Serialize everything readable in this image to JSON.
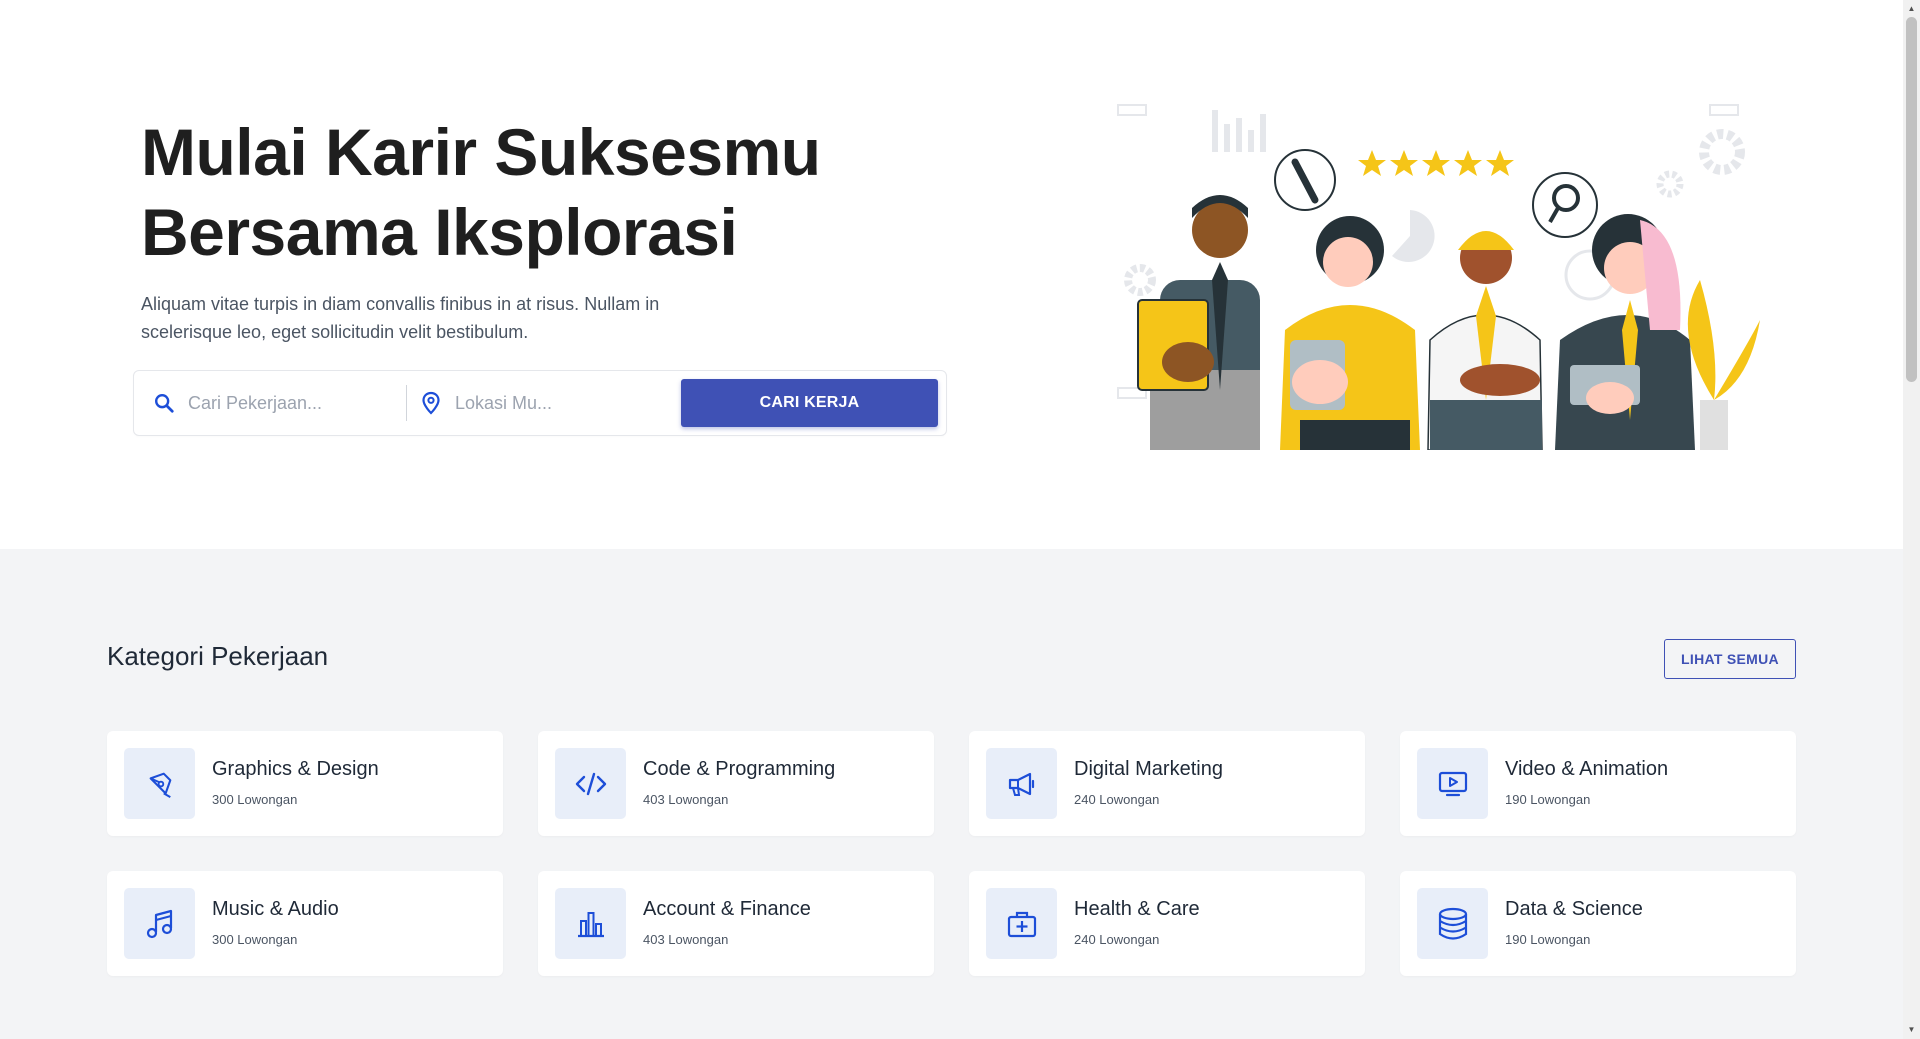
{
  "hero": {
    "title_line1": "Mulai Karir Suksesmu",
    "title_line2": "Bersama Iksplorasi",
    "subtitle": "Aliquam vitae turpis in diam convallis finibus in at risus. Nullam in scelerisque leo, eget sollicitudin velit bestibulum."
  },
  "search": {
    "job_placeholder": "Cari Pekerjaan...",
    "location_placeholder": "Lokasi Mu...",
    "button_label": "CARI KERJA"
  },
  "categories": {
    "title": "Kategori Pekerjaan",
    "see_all_label": "LIHAT SEMUA",
    "items": [
      {
        "name": "Graphics & Design",
        "count": "300 Lowongan",
        "icon": "pen-tool-icon"
      },
      {
        "name": "Code & Programming",
        "count": "403 Lowongan",
        "icon": "code-icon"
      },
      {
        "name": "Digital Marketing",
        "count": "240 Lowongan",
        "icon": "megaphone-icon"
      },
      {
        "name": "Video & Animation",
        "count": "190 Lowongan",
        "icon": "video-play-icon"
      },
      {
        "name": "Music & Audio",
        "count": "300 Lowongan",
        "icon": "music-note-icon"
      },
      {
        "name": "Account & Finance",
        "count": "403 Lowongan",
        "icon": "bar-chart-icon"
      },
      {
        "name": "Health & Care",
        "count": "240 Lowongan",
        "icon": "medical-bag-icon"
      },
      {
        "name": "Data & Science",
        "count": "190 Lowongan",
        "icon": "database-icon"
      }
    ]
  },
  "colors": {
    "primary": "#3f51b5",
    "icon_blue": "#1d4ed8",
    "icon_bg": "#e8eef9",
    "section_bg": "#f3f4f6",
    "accent_yellow": "#f5c518"
  }
}
